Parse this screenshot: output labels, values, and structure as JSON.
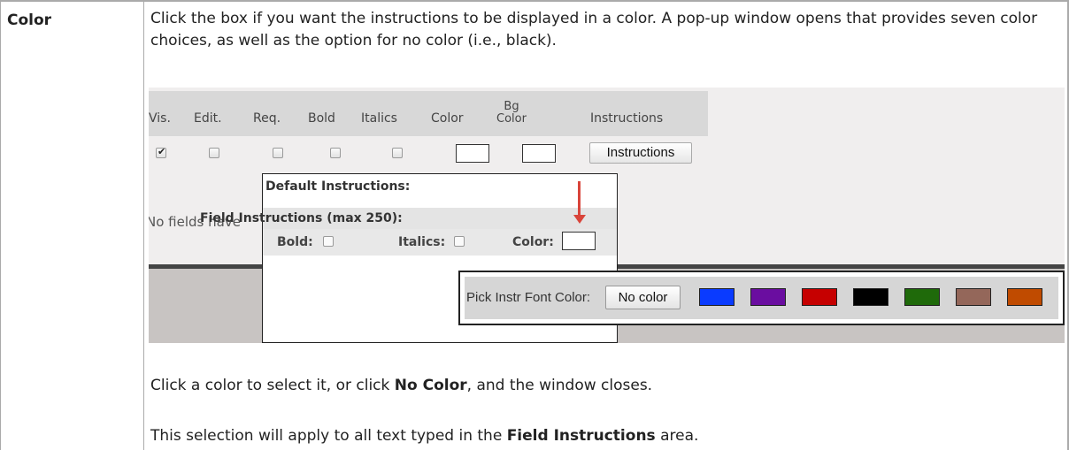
{
  "term": "Color",
  "description": "Click the box if you want the instructions to be displayed in a color. A pop-up window opens that provides seven color choices, as well as the option for no color (i.e., black).",
  "screenshot": {
    "headers": [
      "Vis.",
      "Edit.",
      "Req.",
      "Bold",
      "Italics",
      "Color",
      "Bg Color",
      "Instructions"
    ],
    "bg_color_header_line1": "Bg",
    "bg_color_header_line2": "Color",
    "checkboxes": [
      {
        "name": "vis",
        "checked": true
      },
      {
        "name": "edit",
        "checked": false
      },
      {
        "name": "req",
        "checked": false
      },
      {
        "name": "bold",
        "checked": false
      },
      {
        "name": "italics",
        "checked": false
      }
    ],
    "instructions_button": "Instructions",
    "background_text": "No fields have",
    "popup": {
      "default_instructions_label": "Default Instructions:",
      "field_instructions_label": "Field Instructions (max 250):",
      "bold_label": "Bold:",
      "italics_label": "Italics:",
      "color_label": "Color:"
    },
    "picker": {
      "label": "Pick Instr Font Color:",
      "no_color_button": "No color",
      "swatches": [
        "#0a3bff",
        "#6a0da0",
        "#c60000",
        "#000000",
        "#1f6a0a",
        "#94675a",
        "#c04b00"
      ]
    },
    "arrow_color": "#d9443a"
  },
  "para2": {
    "before": "Click a color to select it, or click ",
    "bold": "No Color",
    "after": ", and the window closes."
  },
  "para3": {
    "before": "This selection will apply to all text typed in the ",
    "bold": "Field Instructions",
    "after": " area."
  }
}
